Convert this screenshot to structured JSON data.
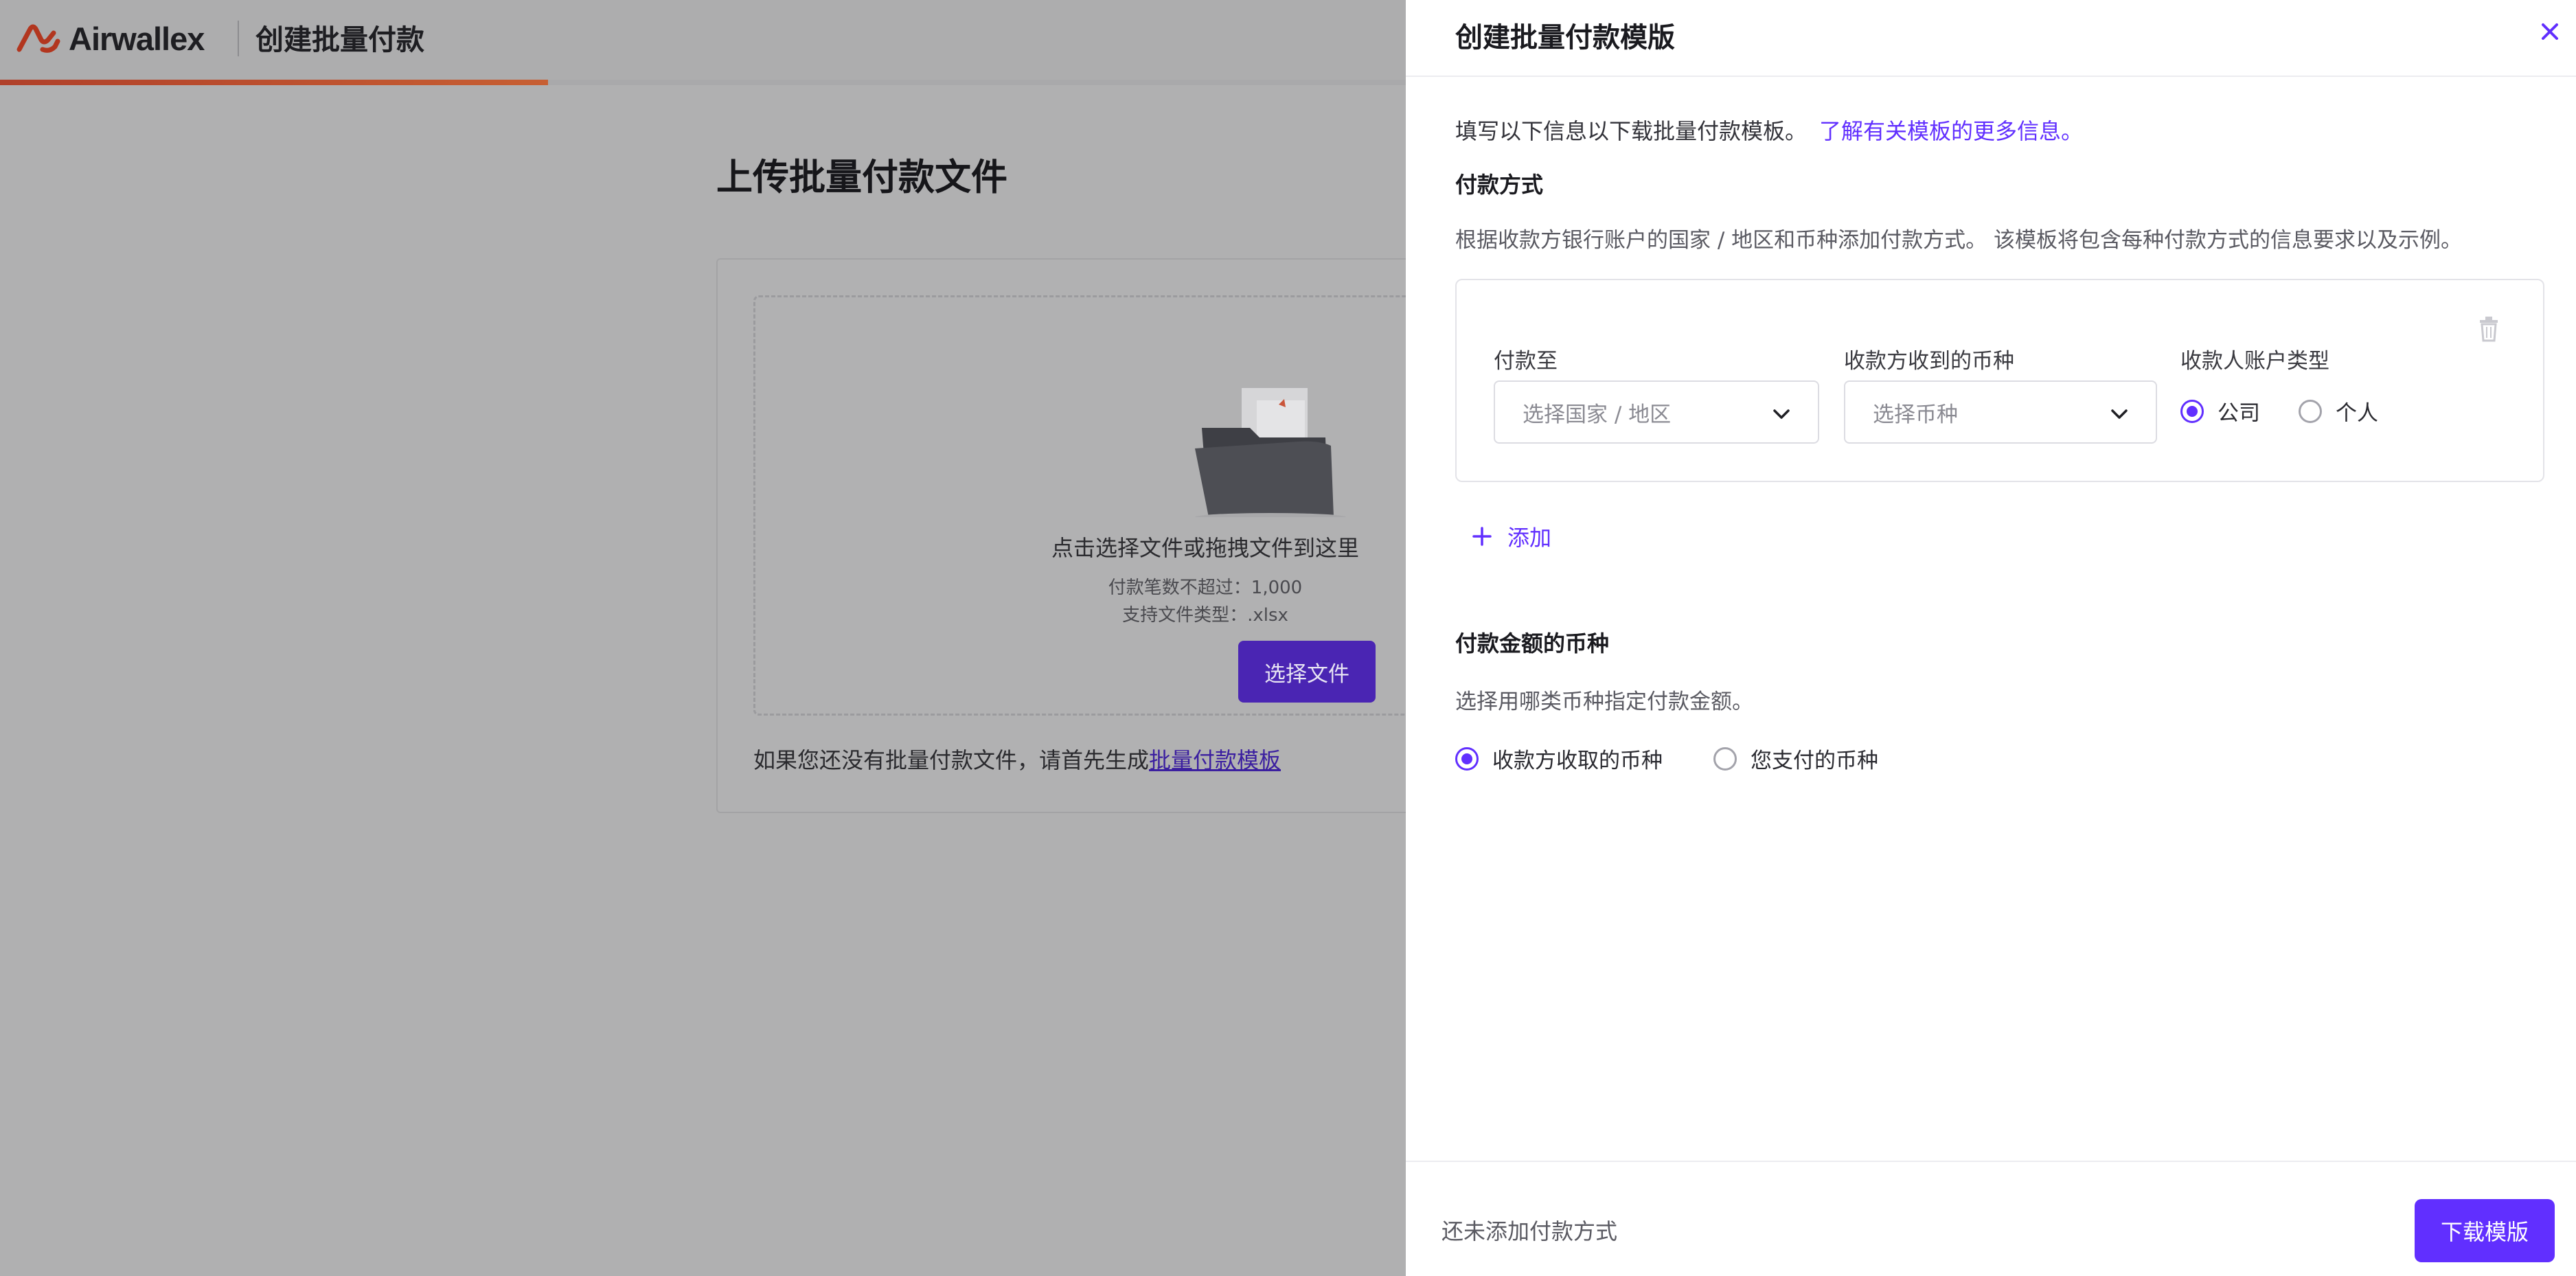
{
  "app": {
    "brand": "Airwallex",
    "title": "创建批量付款",
    "progress_fraction": 0.39
  },
  "page": {
    "heading": "上传批量付款文件",
    "dropzone": {
      "main_text": "点击选择文件或拖拽文件到这里",
      "limit_text": "付款笔数不超过：1,000",
      "type_text": "支持文件类型：.xlsx",
      "button_label": "选择文件"
    },
    "template_hint": {
      "prefix": "如果您还没有批量付款文件，请首先生成",
      "link": "批量付款模板"
    }
  },
  "drawer": {
    "title": "创建批量付款模版",
    "intro_text": "填写以下信息以下载批量付款模板。",
    "intro_link": "了解有关模板的更多信息。",
    "payment_method": {
      "title": "付款方式",
      "description": "根据收款方银行账户的国家 / 地区和币种添加付款方式。 该模板将包含每种付款方式的信息要求以及示例。",
      "card": {
        "destination_label": "付款至",
        "destination_placeholder": "选择国家 / 地区",
        "currency_label": "收款方收到的币种",
        "currency_placeholder": "选择币种",
        "account_type_label": "收款人账户类型",
        "account_types": [
          {
            "label": "公司",
            "selected": true
          },
          {
            "label": "个人",
            "selected": false
          }
        ]
      },
      "add_label": "添加"
    },
    "amount_currency": {
      "title": "付款金额的币种",
      "description": "选择用哪类币种指定付款金额。",
      "options": [
        {
          "label": "收款方收取的币种",
          "selected": true
        },
        {
          "label": "您支付的币种",
          "selected": false
        }
      ]
    },
    "footer": {
      "status": "还未添加付款方式",
      "download_label": "下载模版"
    }
  },
  "colors": {
    "accent": "#612fff",
    "dimmed_button": "#4a25b3",
    "progress": "#c75f33",
    "overlay_bg": "#b0b0b1"
  },
  "icons": {
    "close": "close-icon",
    "trash": "trash-icon",
    "chevron": "chevron-down-icon",
    "plus": "plus-icon",
    "folder": "folder-illustration"
  }
}
